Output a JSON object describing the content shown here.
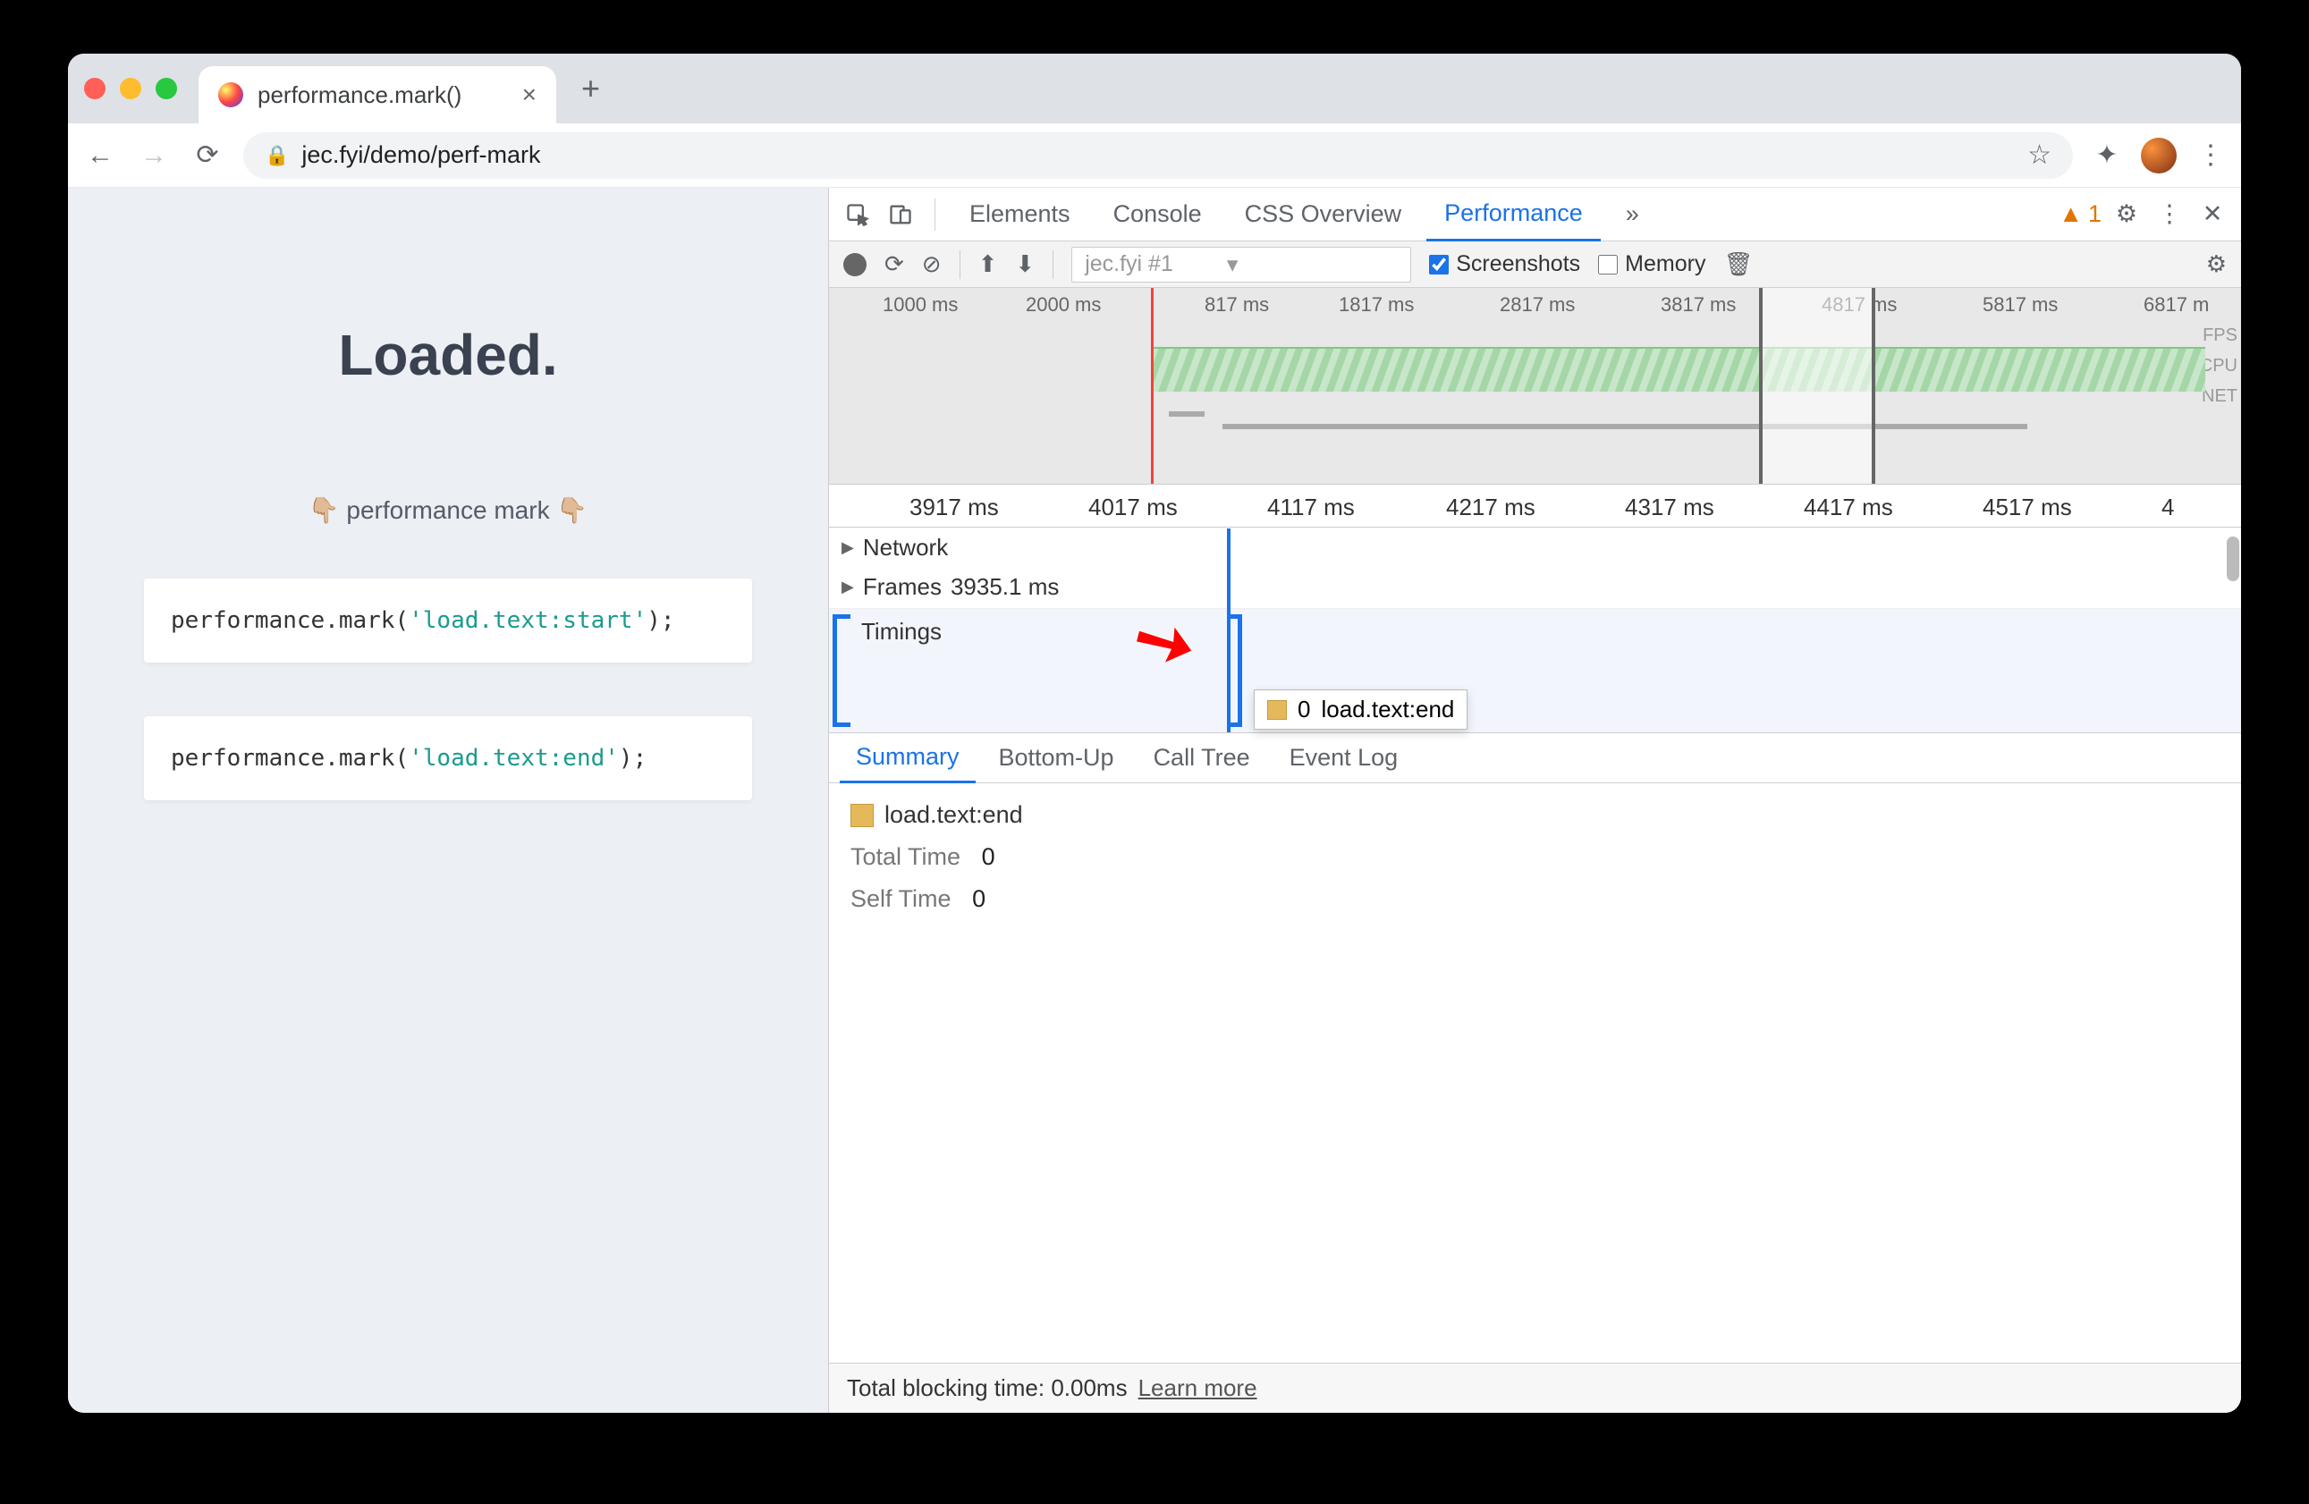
{
  "browser": {
    "tab_title": "performance.mark()",
    "url": "jec.fyi/demo/perf-mark"
  },
  "page": {
    "heading": "Loaded.",
    "subtitle": "👇🏼 performance mark 👇🏼",
    "code1_pre": "performance.mark(",
    "code1_str": "'load.text:start'",
    "code1_post": ");",
    "code2_pre": "performance.mark(",
    "code2_str": "'load.text:end'",
    "code2_post": ");"
  },
  "devtools": {
    "tabs": [
      "Elements",
      "Console",
      "CSS Overview",
      "Performance"
    ],
    "active_tab": "Performance",
    "more_tabs": "»",
    "warn_count": "1"
  },
  "perf_toolbar": {
    "page_selector": "jec.fyi #1",
    "screenshots_label": "Screenshots",
    "memory_label": "Memory",
    "screenshots_checked": true,
    "memory_checked": false
  },
  "overview_ticks": [
    "1000 ms",
    "2000 ms",
    "817 ms",
    "1817 ms",
    "2817 ms",
    "3817 ms",
    "4817 ms",
    "5817 ms",
    "6817 m"
  ],
  "overview_labels": [
    "FPS",
    "CPU",
    "NET"
  ],
  "detail_ticks": [
    "3917 ms",
    "4017 ms",
    "4117 ms",
    "4217 ms",
    "4317 ms",
    "4417 ms",
    "4517 ms",
    "4"
  ],
  "tracks": {
    "network": "Network",
    "frames": "Frames",
    "frames_val": "3935.1 ms",
    "timings": "Timings"
  },
  "tooltip": {
    "time": "0",
    "label": "load.text:end"
  },
  "summary_tabs": [
    "Summary",
    "Bottom-Up",
    "Call Tree",
    "Event Log"
  ],
  "summary_active": "Summary",
  "summary": {
    "title": "load.text:end",
    "total_label": "Total Time",
    "total_val": "0",
    "self_label": "Self Time",
    "self_val": "0"
  },
  "footer": {
    "blocking": "Total blocking time: 0.00ms",
    "learn": "Learn more"
  }
}
